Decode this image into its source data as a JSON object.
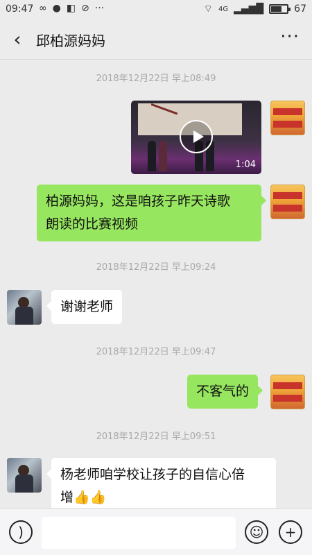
{
  "status_bar": {
    "time": "09:47",
    "left_icons": [
      "infinity-icon",
      "chat-bubble-icon",
      "shield-app-icon",
      "blocked-icon",
      "more-dots-icon"
    ],
    "network": "4G",
    "battery": 67,
    "battery_label": "67"
  },
  "header": {
    "title": "邱柏源妈妈",
    "back_icon": "‹",
    "more_icon": "···"
  },
  "messages": [
    {
      "type": "timestamp",
      "text": "2018年12月22日 早上08:49"
    },
    {
      "type": "video",
      "sender": "me",
      "duration": "1:04"
    },
    {
      "type": "text",
      "sender": "me",
      "lines": [
        "柏源妈妈，这是咱孩子昨天诗歌",
        "朗读的比赛视频"
      ]
    },
    {
      "type": "timestamp",
      "text": "2018年12月22日 早上09:24"
    },
    {
      "type": "text",
      "sender": "them",
      "lines": [
        "谢谢老师"
      ]
    },
    {
      "type": "timestamp",
      "text": "2018年12月22日 早上09:47"
    },
    {
      "type": "text",
      "sender": "me",
      "lines": [
        "不客气的"
      ]
    },
    {
      "type": "timestamp",
      "text": "2018年12月22日 早上09:51"
    },
    {
      "type": "text",
      "sender": "them",
      "lines": [
        "杨老师咱学校让孩子的自信心倍",
        "增👍👍"
      ]
    }
  ],
  "input_bar": {
    "voice_icon": "voice-icon",
    "text_value": "",
    "emoji_icon": "emoji-icon",
    "plus_icon": "plus-icon"
  }
}
